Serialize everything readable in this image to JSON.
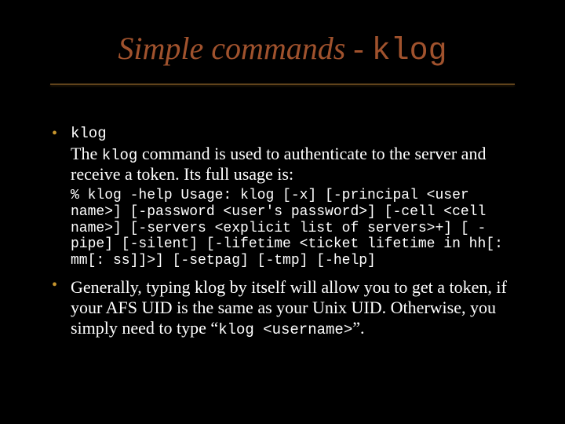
{
  "title": {
    "prefix": "Simple commands - ",
    "command": "klog"
  },
  "bullet1": {
    "head": "klog",
    "desc_before": "The ",
    "desc_mono": "klog",
    "desc_after": " command is used to authenticate to the server and receive a token.  Its full usage is:",
    "usage": "% klog -help\nUsage: klog [-x] [-principal <user name>] [-password <user's password>] [-cell <cell name>] [-servers <explicit list of servers>+] [ -pipe] [-silent] [-lifetime <ticket lifetime in hh[: mm[: ss]]>] [-setpag] [-tmp] [-help]"
  },
  "bullet2": {
    "before": "Generally, typing klog by itself will allow you to get a token, if your AFS UID is the same as your Unix UID.  Otherwise, you simply need to type “",
    "mono": "klog <username>",
    "after": "”."
  }
}
